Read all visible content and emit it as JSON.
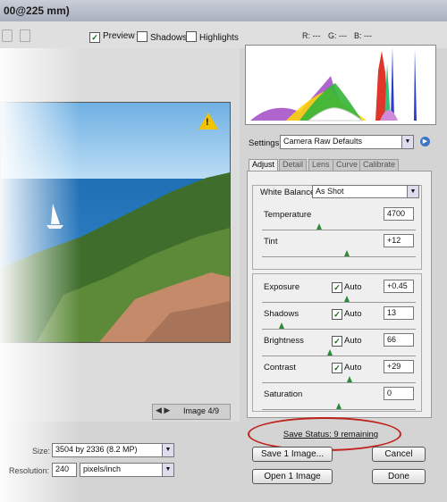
{
  "window": {
    "title_fragment": "00@225 mm)"
  },
  "toolbar": {
    "preview_label": "Preview",
    "preview_checked": "✓",
    "shadows_label": "Shadows",
    "highlights_label": "Highlights",
    "r_readout": "R: ---",
    "g_readout": "G: ---",
    "b_readout": "B: ---"
  },
  "preview": {
    "image_counter": "Image 4/9",
    "nav_glyphs": "◀ ▶",
    "warning_glyph": "!"
  },
  "image_info": {
    "size_label": "Size:",
    "size_value": "3504 by 2336  (8.2 MP)",
    "resolution_label": "Resolution:",
    "resolution_value": "240",
    "resolution_unit": "pixels/inch"
  },
  "settings": {
    "label": "Settings:",
    "value": "Camera Raw Defaults"
  },
  "tabs": [
    "Adjust",
    "Detail",
    "Lens",
    "Curve",
    "Calibrate"
  ],
  "adjust": {
    "white_balance_label": "White Balance:",
    "white_balance_value": "As Shot",
    "temperature": {
      "label": "Temperature",
      "value": "4700",
      "level": 0.37
    },
    "tint": {
      "label": "Tint",
      "value": "+12",
      "level": 0.55
    },
    "exposure": {
      "label": "Exposure",
      "auto": "Auto",
      "value": "+0.45",
      "level": 0.55
    },
    "shadows": {
      "label": "Shadows",
      "auto": "Auto",
      "value": "13",
      "level": 0.13
    },
    "brightness": {
      "label": "Brightness",
      "auto": "Auto",
      "value": "66",
      "level": 0.44
    },
    "contrast": {
      "label": "Contrast",
      "auto": "Auto",
      "value": "+29",
      "level": 0.57
    },
    "saturation": {
      "label": "Saturation",
      "value": "0",
      "level": 0.5
    },
    "auto_check": "✓"
  },
  "status": {
    "save_status": "Save Status: 9 remaining"
  },
  "buttons": {
    "save": "Save 1 Image...",
    "cancel": "Cancel",
    "open": "Open 1 Image",
    "done": "Done"
  },
  "colors": {
    "accent_red": "#c0211b",
    "slider_thumb": "#2d8a3a"
  }
}
